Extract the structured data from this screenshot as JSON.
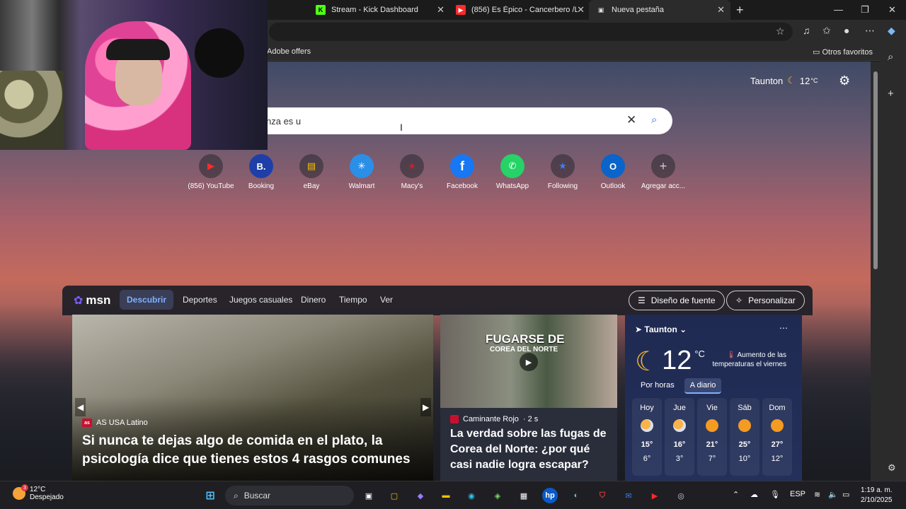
{
  "tabs": [
    {
      "label": "Stream - Kick Dashboard",
      "favicon": "K"
    },
    {
      "label": "(856) Es Épico - Cancerbero /Letr",
      "favicon": "▶"
    },
    {
      "label": "Nueva pestaña",
      "favicon": "▣"
    }
  ],
  "favorites_bar": {
    "left_item": "Adobe offers",
    "right_item": "Otros favoritos"
  },
  "top_weather": {
    "city": "Taunton",
    "temp": "12",
    "unit": "°C"
  },
  "search": {
    "query": "nza es u"
  },
  "quick_links": [
    {
      "label": "(856) YouTube",
      "glyph": "▶",
      "color": "#ff2a2a"
    },
    {
      "label": "Booking",
      "glyph": "B.",
      "color": "#1e3fa8"
    },
    {
      "label": "eBay",
      "glyph": "▤",
      "color": "#f5c400"
    },
    {
      "label": "Walmart",
      "glyph": "✳",
      "color": "#2b8fe8"
    },
    {
      "label": "Macy's",
      "glyph": "★",
      "color": "#cf1d2b"
    },
    {
      "label": "Facebook",
      "glyph": "f",
      "color": "#1877f2"
    },
    {
      "label": "WhatsApp",
      "glyph": "✆",
      "color": "#25d366"
    },
    {
      "label": "Following",
      "glyph": "★",
      "color": "#3b7bff"
    },
    {
      "label": "Outlook",
      "glyph": "O",
      "color": "#0a64c9"
    },
    {
      "label": "Agregar acc...",
      "glyph": "+",
      "color": "#cccccc"
    }
  ],
  "msn": {
    "logo": "msn",
    "nav": [
      "Descubrir",
      "Deportes",
      "Juegos casuales",
      "Dinero",
      "Tiempo",
      "Ver"
    ],
    "font_button": "Diseño de fuente",
    "personalize_button": "Personalizar"
  },
  "card_main": {
    "source": "AS USA Latino",
    "source_badge": "as",
    "title": "Si nunca te dejas algo de comida en el plato, la psicología dice que tienes estos 4 rasgos comunes"
  },
  "card_video": {
    "thumb_headline": "FUGARSE DE",
    "thumb_subheadline": "COREA DEL NORTE",
    "source": "Caminante Rojo",
    "age": "· 2 s",
    "title": "La verdad sobre las fugas de Corea del Norte: ¿por qué casi nadie logra escapar?"
  },
  "weather_card": {
    "location": "Taunton",
    "temp": "12",
    "unit": "°C",
    "alert": "Aumento de las temperaturas el viernes",
    "tab_hourly": "Por horas",
    "tab_daily": "A diario",
    "days": [
      {
        "name": "Hoy",
        "hi": "15°",
        "lo": "6°",
        "icon": "partly-cloudy"
      },
      {
        "name": "Jue",
        "hi": "16°",
        "lo": "3°",
        "icon": "partly-cloudy"
      },
      {
        "name": "Vie",
        "hi": "21°",
        "lo": "7°",
        "icon": "sunny"
      },
      {
        "name": "Sáb",
        "hi": "25°",
        "lo": "10°",
        "icon": "sunny"
      },
      {
        "name": "Dom",
        "hi": "27°",
        "lo": "12°",
        "icon": "sunny"
      }
    ]
  },
  "taskbar": {
    "weather_temp": "12°C",
    "weather_desc": "Despejado",
    "weather_badge": "3",
    "search_placeholder": "Buscar",
    "lang": "ESP",
    "time": "1:19 a. m.",
    "date": "2/10/2025"
  }
}
